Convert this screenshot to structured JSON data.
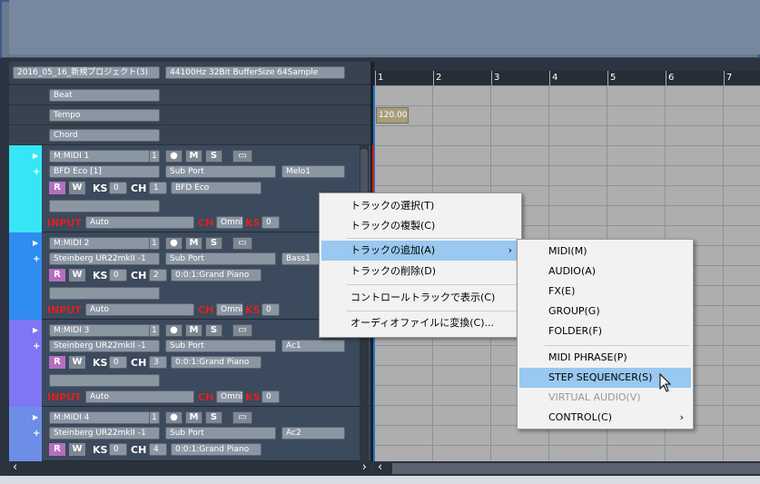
{
  "header": {
    "project": "2016_05_16_新規プロジェクト(3)",
    "info": "44100Hz 32Bit BufferSize 64Sample"
  },
  "control_tracks": [
    "Beat",
    "Tempo",
    "Chord"
  ],
  "ruler": [
    "1",
    "2",
    "3",
    "4",
    "5",
    "6",
    "7"
  ],
  "tempo_value": "120.00",
  "tracks": [
    {
      "name": "M:MIDI 1",
      "num": "1",
      "device": "BFD Eco [1]",
      "port": "Sub Port",
      "slot": "Melo1",
      "ks": "0",
      "ch": "1",
      "program": "BFD Eco",
      "input_label": "INPUT",
      "input": "Auto",
      "ch_label": "CH",
      "omni": "Omni",
      "ks_label": "KS",
      "ks2": "0",
      "color": "#36e6f6"
    },
    {
      "name": "M:MIDI 2",
      "num": "1",
      "device": "Steinberg UR22mkII -1",
      "port": "Sub Port",
      "slot": "Bass1",
      "ks": "0",
      "ch": "2",
      "program": "0:0:1:Grand Piano",
      "input_label": "INPUT",
      "input": "Auto",
      "ch_label": "CH",
      "omni": "Omni",
      "ks_label": "KS",
      "ks2": "0",
      "color": "#2f8cf0"
    },
    {
      "name": "M:MIDI 3",
      "num": "1",
      "device": "Steinberg UR22mkII -1",
      "port": "Sub Port",
      "slot": "Ac1",
      "ks": "0",
      "ch": "3",
      "program": "0:0:1:Grand Piano",
      "input_label": "INPUT",
      "input": "Auto",
      "ch_label": "CH",
      "omni": "Omni",
      "ks_label": "KS",
      "ks2": "0",
      "color": "#7f76f4"
    },
    {
      "name": "M:MIDI 4",
      "num": "1",
      "device": "Steinberg UR22mkII -1",
      "port": "Sub Port",
      "slot": "Ac2",
      "ks": "0",
      "ch": "4",
      "program": "0:0:1:Grand Piano",
      "color": "#6d8ee6"
    }
  ],
  "labels": {
    "r": "R",
    "w": "W",
    "ks": "KS",
    "ch": "CH",
    "m": "M",
    "s": "S"
  },
  "context_menu": [
    "トラックの選択(T)",
    "トラックの複製(C)",
    "トラックの追加(A)",
    "トラックの削除(D)",
    "コントロールトラックで表示(C)",
    "オーディオファイルに変換(C)..."
  ],
  "submenu": [
    "MIDI(M)",
    "AUDIO(A)",
    "FX(E)",
    "GROUP(G)",
    "FOLDER(F)",
    "MIDI PHRASE(P)",
    "STEP SEQUENCER(S)",
    "VIRTUAL AUDIO(V)",
    "CONTROL(C)"
  ],
  "arrows": {
    "right": "›",
    "scroll_left": "‹",
    "scroll_right": "›",
    "play": "▶",
    "plus": "+"
  }
}
